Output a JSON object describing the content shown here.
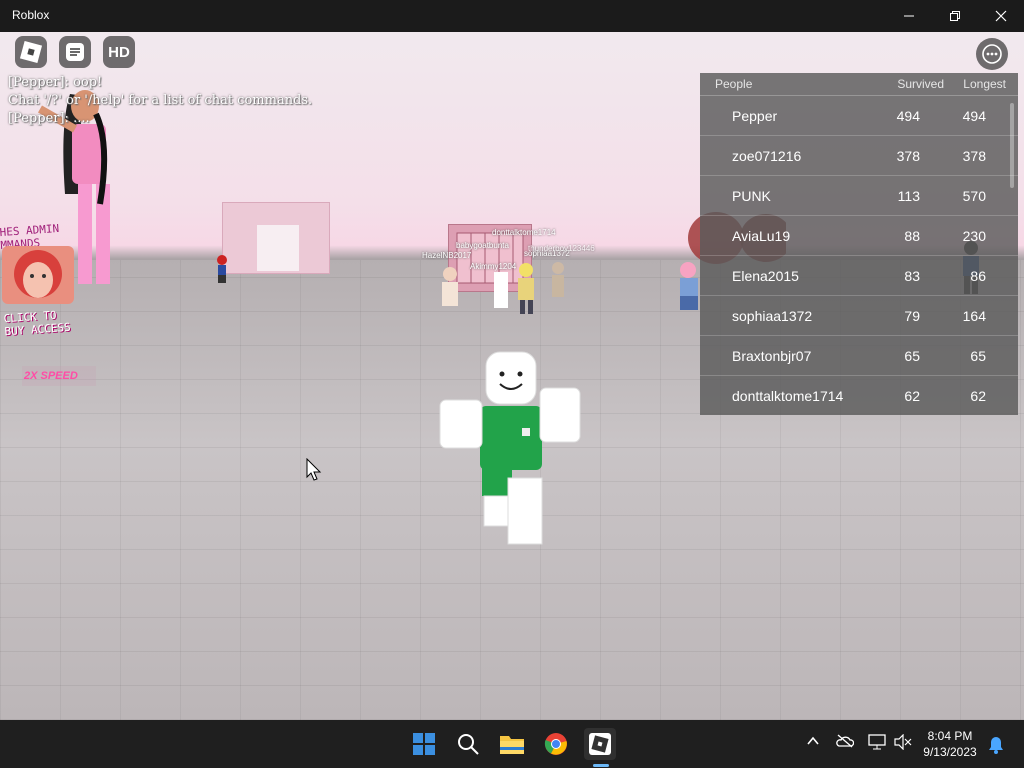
{
  "window": {
    "title": "Roblox"
  },
  "hud": {
    "hd_label": "HD"
  },
  "chat": {
    "lines": [
      "[Pepper]: oop!",
      "Chat '/?' or '/help' for a list of chat commands.",
      "[Pepper]: ...."
    ]
  },
  "leaderboard": {
    "headers": [
      "People",
      "Survived",
      "Longest"
    ],
    "rows": [
      {
        "name": "Pepper",
        "survived": "494",
        "longest": "494"
      },
      {
        "name": "zoe071216",
        "survived": "378",
        "longest": "378"
      },
      {
        "name": "PUNK",
        "survived": "113",
        "longest": "570"
      },
      {
        "name": "AviaLu19",
        "survived": "88",
        "longest": "230"
      },
      {
        "name": "Elena2015",
        "survived": "83",
        "longest": "86"
      },
      {
        "name": "sophiaa1372",
        "survived": "79",
        "longest": "164"
      },
      {
        "name": "Braxtonbjr07",
        "survived": "65",
        "longest": "65"
      },
      {
        "name": "donttalktome1714",
        "survived": "62",
        "longest": "62"
      }
    ]
  },
  "scene": {
    "sign_commands": "HES ADMIN\nMMANDS",
    "sign_buy": "CLICK TO\nBUY ACCESS",
    "speed_label": "2X SPEED",
    "nametags": [
      "donttalktome1714",
      "babygoatbunta",
      "HazelNB2017",
      "Akimmy1204",
      "sophiaa1372",
      "thunderboy123446"
    ]
  },
  "taskbar": {
    "time": "8:04 PM",
    "date": "9/13/2023"
  },
  "colors": {
    "accent_blue": "#3b8fe0",
    "leaderboard_bg": "#5a5a5a"
  }
}
